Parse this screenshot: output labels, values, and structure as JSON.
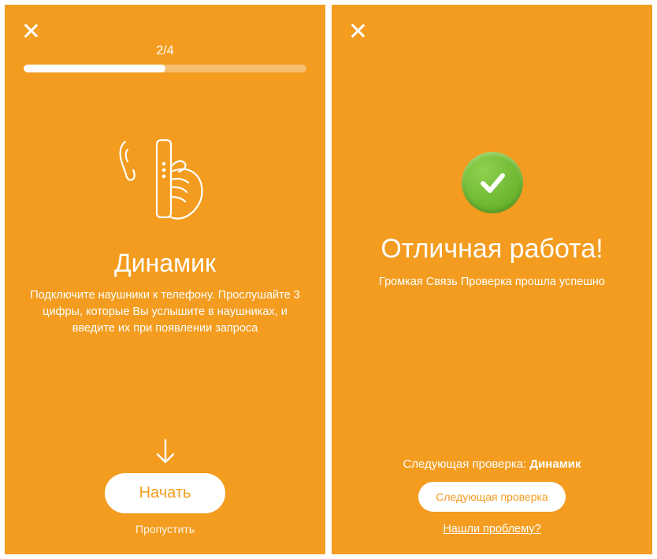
{
  "screen1": {
    "progress_text": "2/4",
    "progress_percent": 50,
    "title": "Динамик",
    "description": "Подключите наушники к телефону. Прослушайте 3 цифры, которые Вы услышите в наушниках, и введите их при появлении запроса",
    "start_button": "Начать",
    "skip_link": "Пропустить"
  },
  "screen2": {
    "title": "Отличная работа!",
    "description": "Громкая Связь Проверка прошла успешно",
    "next_prefix": "Следующая проверка: ",
    "next_name": "Динамик",
    "next_button": "Следующая проверка",
    "problem_link": "Нашли проблему?"
  }
}
